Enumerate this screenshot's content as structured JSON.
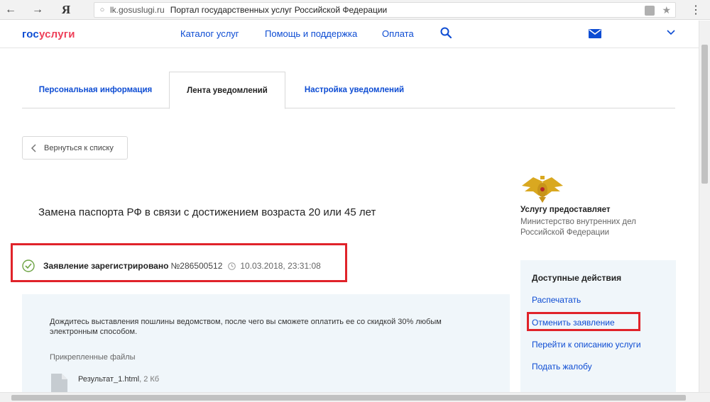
{
  "browser": {
    "logo_letter": "Я",
    "domain": "lk.gosuslugi.ru",
    "page_title": "Портал государственных услуг Российской Федерации"
  },
  "header": {
    "logo_part1": "гос",
    "logo_part2": "услуги",
    "nav": [
      "Каталог услуг",
      "Помощь и поддержка",
      "Оплата"
    ]
  },
  "tabs": [
    {
      "label": "Персональная информация",
      "active": false
    },
    {
      "label": "Лента уведомлений",
      "active": true
    },
    {
      "label": "Настройка уведомлений",
      "active": false
    }
  ],
  "back_button": "Вернуться к списку",
  "service_title": "Замена паспорта РФ в связи с достижением возраста 20 или 45 лет",
  "status": {
    "text": "Заявление зарегистрировано",
    "number": "№286500512",
    "datetime": "10.03.2018, 23:31:08"
  },
  "info": {
    "message": "Дождитесь выставления пошлины ведомством, после чего вы сможете оплатить ее со скидкой 30% любым электронным способом.",
    "files_label": "Прикрепленные файлы",
    "file_name": "Результат_1.html",
    "file_size": ", 2 Кб"
  },
  "provider": {
    "label": "Услугу предоставляет",
    "name": "Министерство внутренних дел Российской Федерации"
  },
  "actions": {
    "title": "Доступные действия",
    "items": [
      "Распечатать",
      "Отменить заявление",
      "Перейти к описанию услуги",
      "Подать жалобу"
    ]
  },
  "colors": {
    "link_blue": "#0d4cd3",
    "logo_red": "#ee3f58",
    "highlight_red": "#e0232a",
    "panel_bg": "#f0f6fa",
    "check_green": "#6ea445"
  }
}
